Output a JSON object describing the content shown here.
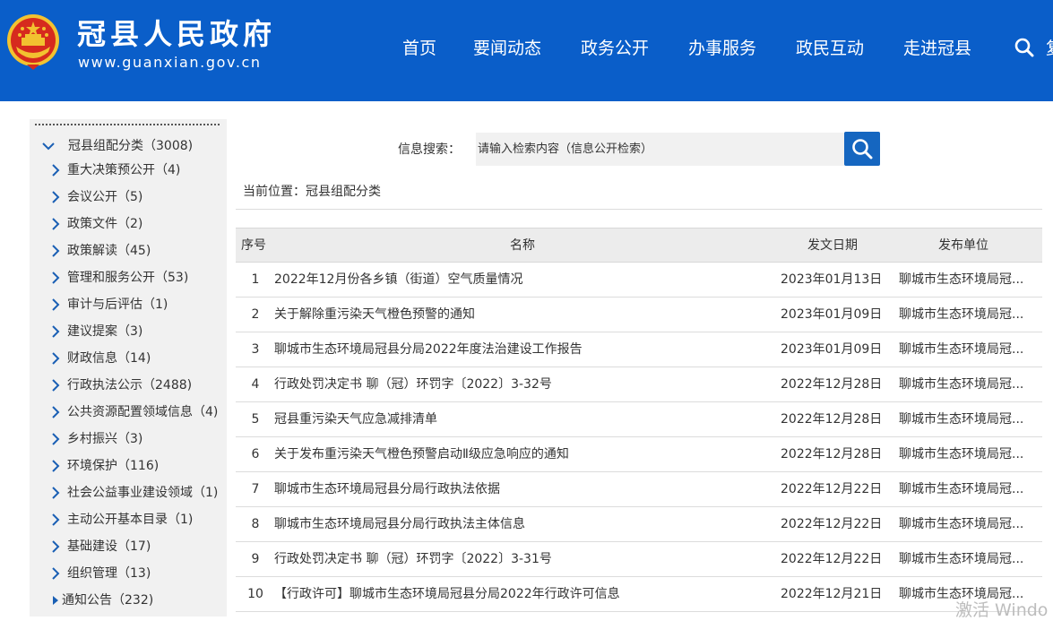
{
  "header": {
    "title": "冠县人民政府",
    "url": "www.guanxian.gov.cn",
    "nav": [
      "首页",
      "要闻动态",
      "政务公开",
      "办事服务",
      "政民互动",
      "走进冠县"
    ],
    "nav_partial": "复",
    "search_icon": "search-icon",
    "emblem_icon": "national-emblem-icon",
    "colors": {
      "brand_blue": "#0a5ec9",
      "button_blue": "#1566c0",
      "sidebar_bg": "#f1f1f1"
    }
  },
  "sidebar": {
    "root_label": "冠县组配分类（3008)",
    "items": [
      "重大决策预公开（4)",
      "会议公开（5)",
      "政策文件（2)",
      "政策解读（45)",
      "管理和服务公开（53)",
      "审计与后评估（1)",
      "建议提案（3)",
      "财政信息（14)",
      "行政执法公示（2488)",
      "公共资源配置领域信息（4)",
      "乡村振兴（3)",
      "环境保护（116)",
      "社会公益事业建设领域（1)",
      "主动公开基本目录（1)",
      "基础建设（17)",
      "组织管理（13)"
    ],
    "selected_item": "通知公告（232)"
  },
  "search": {
    "label": "信息搜索：",
    "placeholder": "请输入检索内容（信息公开检索）"
  },
  "breadcrumb": "当前位置：冠县组配分类",
  "table": {
    "headers": [
      "序号",
      "名称",
      "发文日期",
      "发布单位"
    ],
    "rows": [
      {
        "no": "1",
        "title": "2022年12月份各乡镇（街道）空气质量情况",
        "date": "2023年01月13日",
        "unit": "聊城市生态环境局冠..."
      },
      {
        "no": "2",
        "title": "关于解除重污染天气橙色预警的通知",
        "date": "2023年01月09日",
        "unit": "聊城市生态环境局冠..."
      },
      {
        "no": "3",
        "title": "聊城市生态环境局冠县分局2022年度法治建设工作报告",
        "date": "2023年01月09日",
        "unit": "聊城市生态环境局冠..."
      },
      {
        "no": "4",
        "title": "行政处罚决定书 聊（冠）环罚字〔2022〕3-32号",
        "date": "2022年12月28日",
        "unit": "聊城市生态环境局冠..."
      },
      {
        "no": "5",
        "title": "冠县重污染天气应急减排清单",
        "date": "2022年12月28日",
        "unit": "聊城市生态环境局冠..."
      },
      {
        "no": "6",
        "title": "关于发布重污染天气橙色预警启动Ⅱ级应急响应的通知",
        "date": "2022年12月28日",
        "unit": "聊城市生态环境局冠..."
      },
      {
        "no": "7",
        "title": "聊城市生态环境局冠县分局行政执法依据",
        "date": "2022年12月22日",
        "unit": "聊城市生态环境局冠..."
      },
      {
        "no": "8",
        "title": "聊城市生态环境局冠县分局行政执法主体信息",
        "date": "2022年12月22日",
        "unit": "聊城市生态环境局冠..."
      },
      {
        "no": "9",
        "title": "行政处罚决定书 聊（冠）环罚字〔2022〕3-31号",
        "date": "2022年12月22日",
        "unit": "聊城市生态环境局冠..."
      },
      {
        "no": "10",
        "title": "【行政许可】聊城市生态环境局冠县分局2022年行政许可信息",
        "date": "2022年12月21日",
        "unit": "聊城市生态环境局冠..."
      }
    ]
  },
  "watermark": "激活 Windo"
}
